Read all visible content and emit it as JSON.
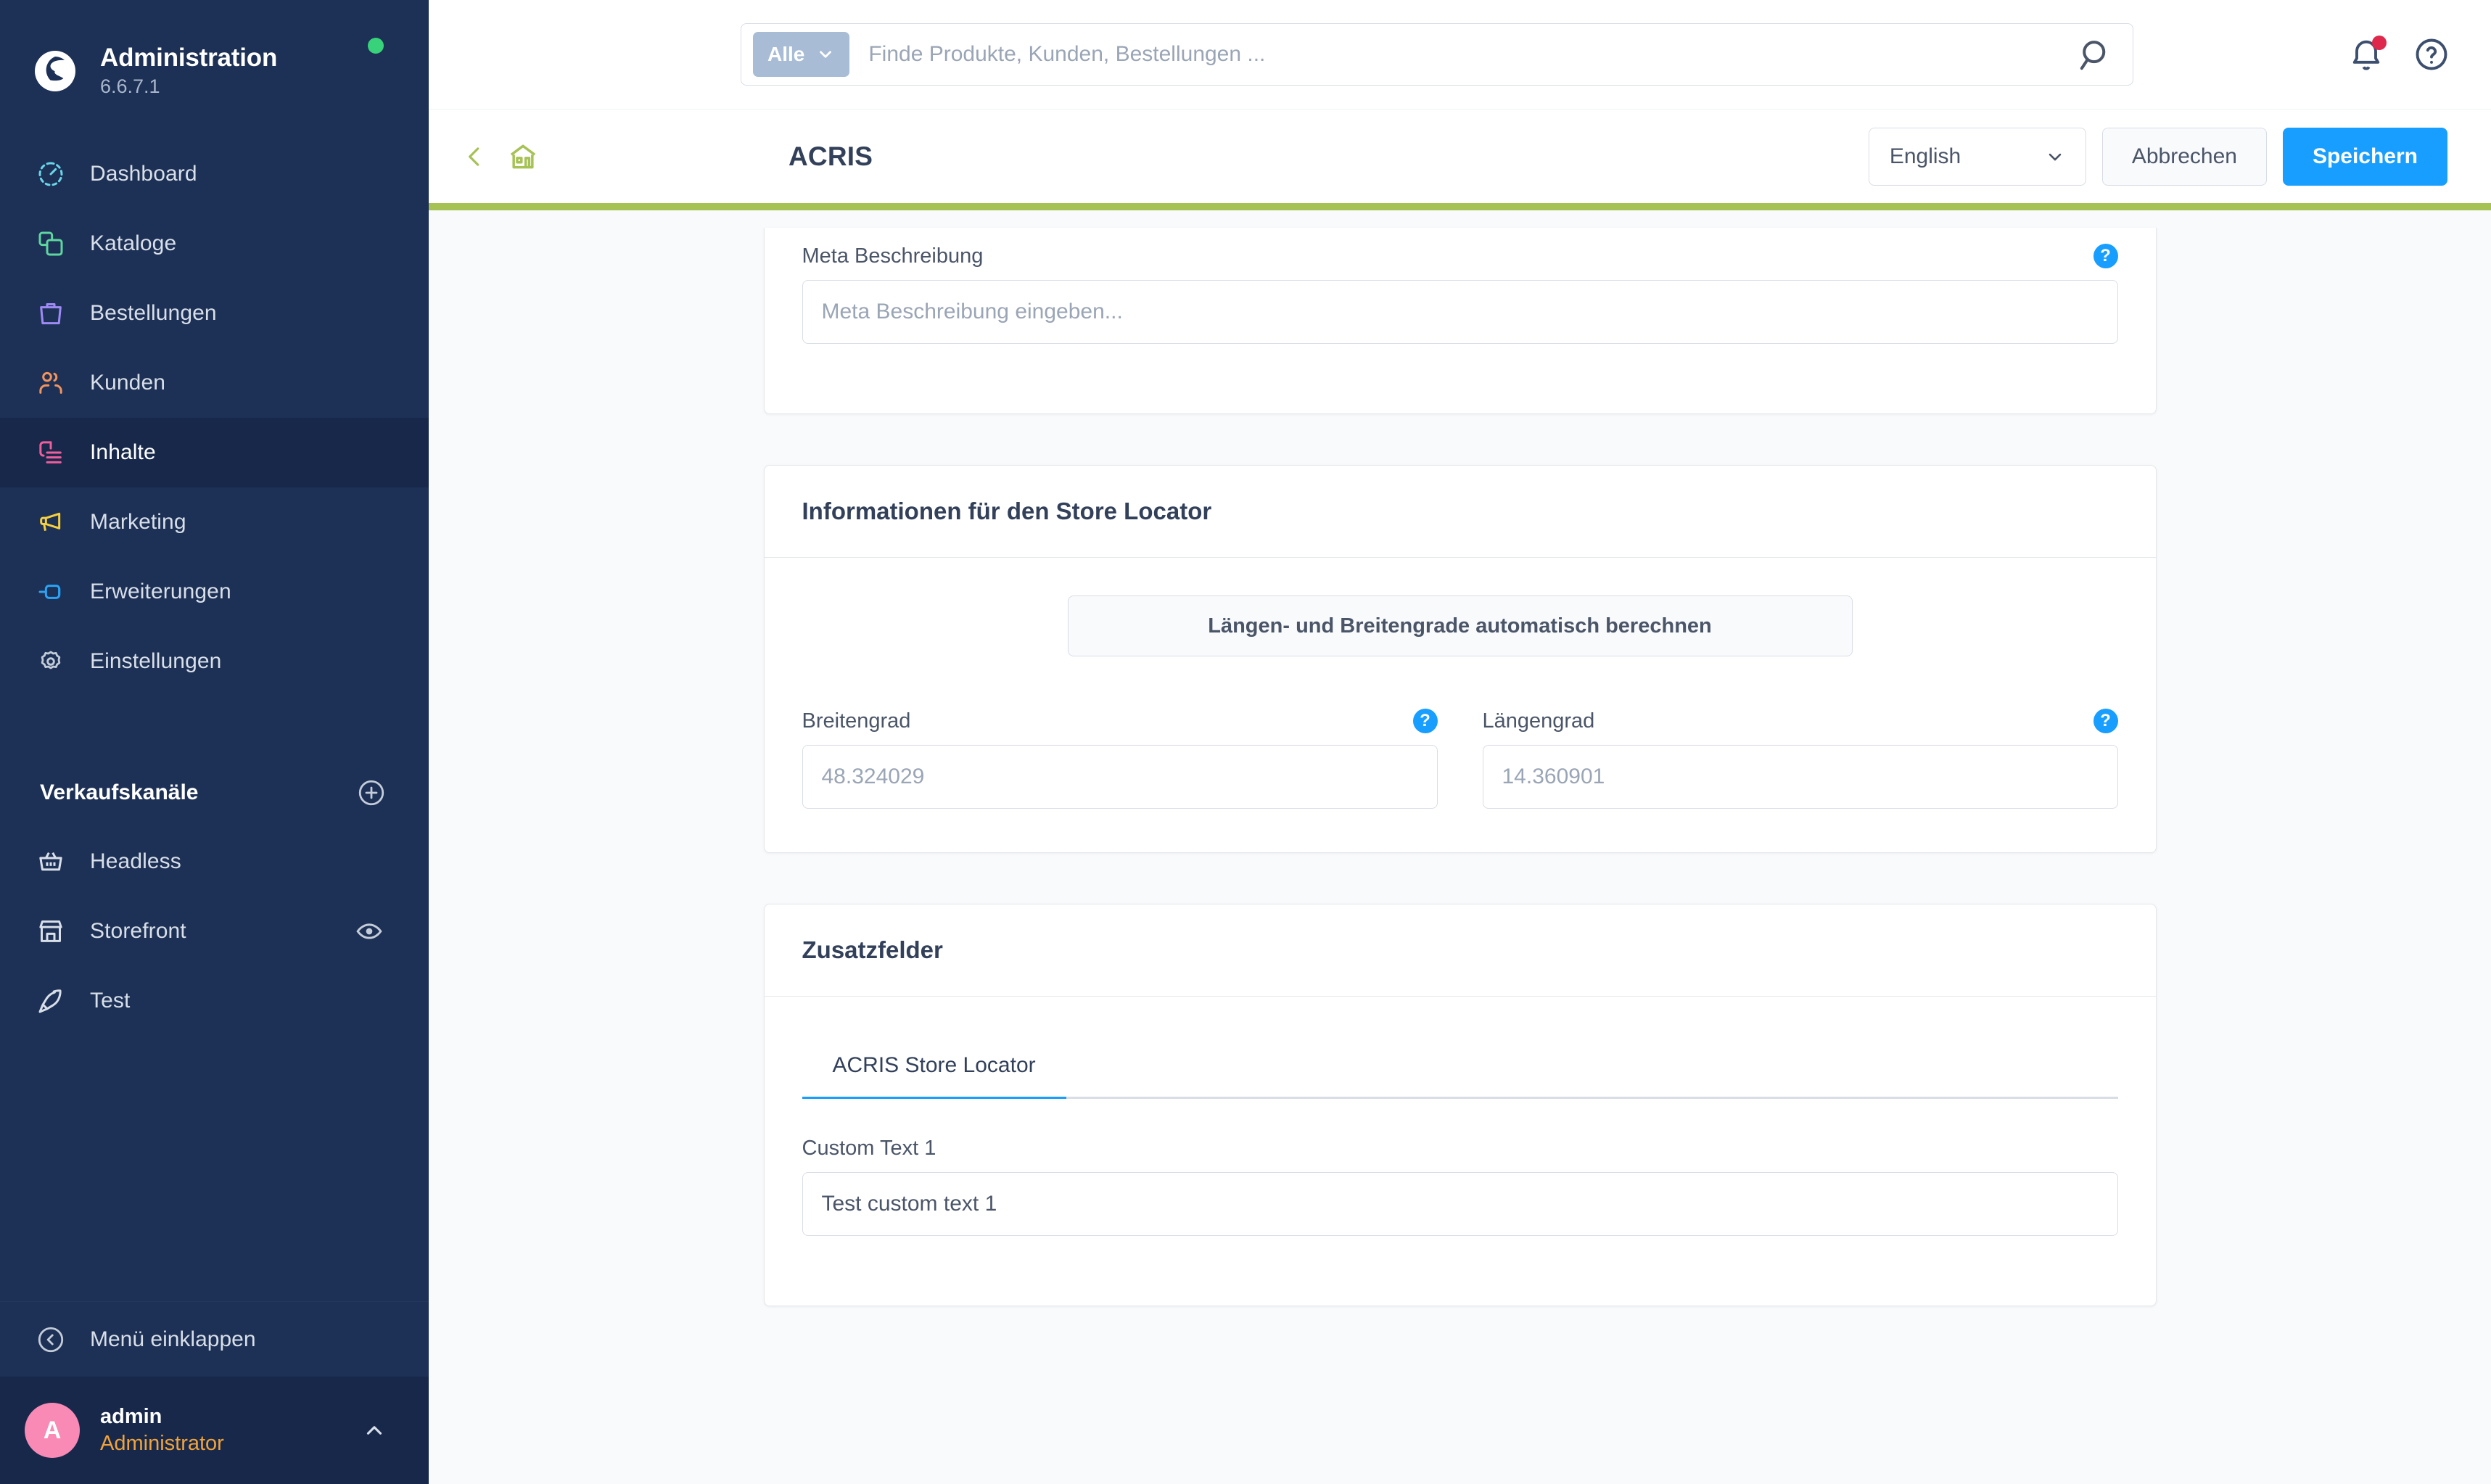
{
  "sidebar": {
    "brand": {
      "title": "Administration",
      "version": "6.6.7.1",
      "status_color": "#37d279"
    },
    "nav": [
      {
        "label": "Dashboard",
        "icon": "gauge-icon",
        "color": "#6bd6e8",
        "active": false
      },
      {
        "label": "Kataloge",
        "icon": "catalog-icon",
        "color": "#5ed6a0",
        "active": false
      },
      {
        "label": "Bestellungen",
        "icon": "bag-icon",
        "color": "#9e8af5",
        "active": false
      },
      {
        "label": "Kunden",
        "icon": "users-icon",
        "color": "#f2945e",
        "active": false
      },
      {
        "label": "Inhalte",
        "icon": "content-icon",
        "color": "#ef5e9c",
        "active": true
      },
      {
        "label": "Marketing",
        "icon": "megaphone-icon",
        "color": "#f5cf3d",
        "active": false
      },
      {
        "label": "Erweiterungen",
        "icon": "plug-icon",
        "color": "#2aa3f5",
        "active": false
      },
      {
        "label": "Einstellungen",
        "icon": "gear-icon",
        "color": "#c3ccd9",
        "active": false
      }
    ],
    "sales_channels_title": "Verkaufskanäle",
    "sales_channels": [
      {
        "label": "Headless",
        "icon": "basket-icon",
        "has_preview": false
      },
      {
        "label": "Storefront",
        "icon": "store-icon",
        "has_preview": true
      },
      {
        "label": "Test",
        "icon": "rocket-icon",
        "has_preview": false
      }
    ],
    "collapse_label": "Menü einklappen",
    "user": {
      "initial": "A",
      "name": "admin",
      "role": "Administrator",
      "avatar_color": "#f88ab5"
    }
  },
  "topbar": {
    "search_scope": "Alle",
    "search_placeholder": "Finde Produkte, Kunden, Bestellungen ...",
    "search_value": "",
    "notification_dot_color": "#de294c"
  },
  "pageheader": {
    "title": "ACRIS",
    "language": "English",
    "cancel_label": "Abbrechen",
    "save_label": "Speichern",
    "accent_color": "#a6c255",
    "primary_color": "#189eff"
  },
  "cards": {
    "meta": {
      "field_label": "Meta Beschreibung",
      "placeholder": "Meta Beschreibung eingeben...",
      "value": "",
      "help": "?"
    },
    "store_locator": {
      "title": "Informationen für den Store Locator",
      "calc_button": "Längen- und Breitengrade automatisch berechnen",
      "latitude": {
        "label": "Breitengrad",
        "value": "48.324029",
        "help": "?"
      },
      "longitude": {
        "label": "Längengrad",
        "value": "14.360901",
        "help": "?"
      }
    },
    "custom_fields": {
      "title": "Zusatzfelder",
      "tabs": [
        {
          "label": "ACRIS Store Locator",
          "active": true
        }
      ],
      "fields": [
        {
          "label": "Custom Text 1",
          "value": "Test custom text 1",
          "placeholder": ""
        }
      ]
    }
  }
}
